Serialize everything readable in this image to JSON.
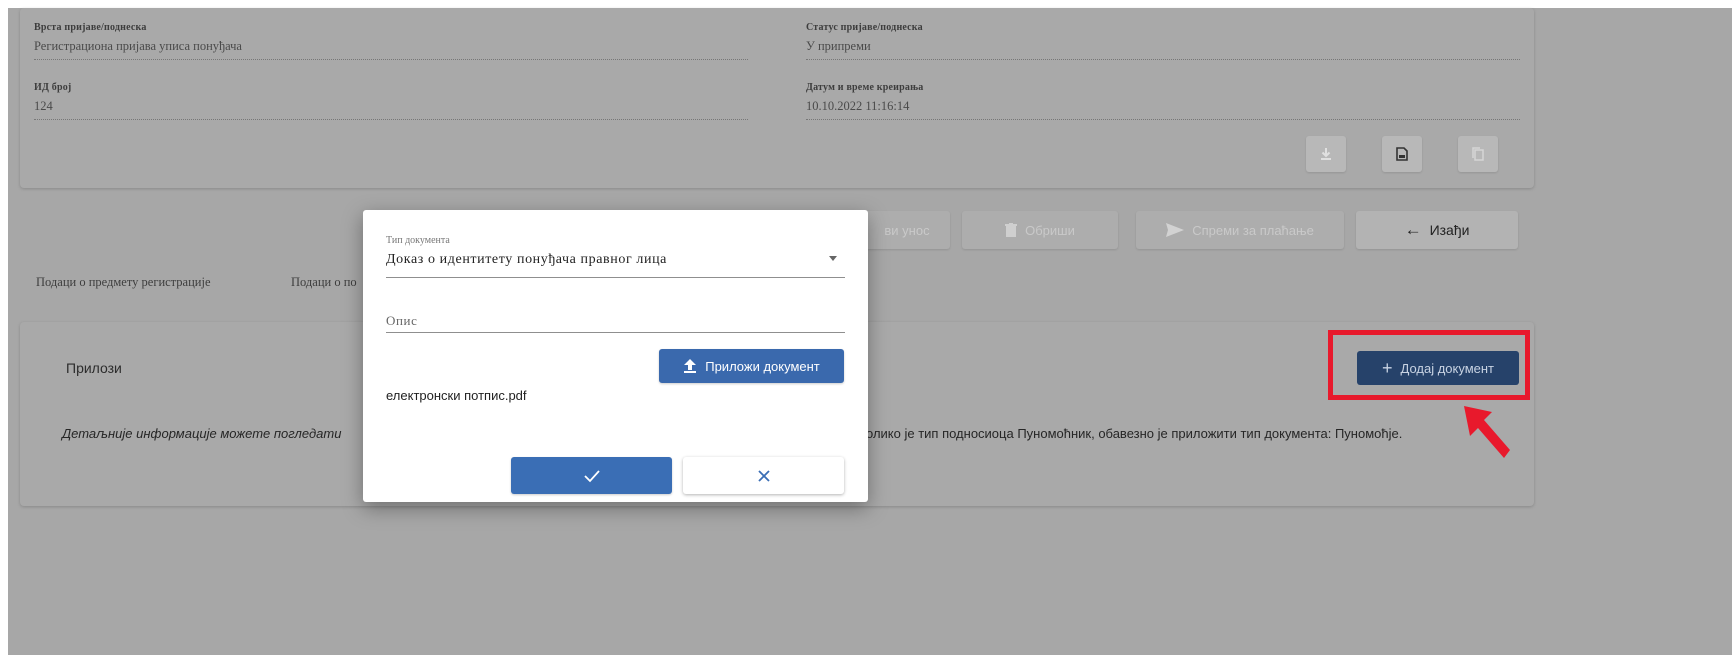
{
  "header_fields": {
    "request_type_label": "Врста пријаве/поднеска",
    "request_type_value": "Регистрациона пријава уписа понуђача",
    "status_label": "Статус пријаве/поднеска",
    "status_value": "У припреми",
    "id_label": "ИД број",
    "id_value": "124",
    "created_label": "Датум и време креирања",
    "created_value": "10.10.2022 11:16:14"
  },
  "header_icons": [
    "download-icon",
    "save-icon",
    "copy-icon"
  ],
  "actions": {
    "save_entry_partial": "ви унос",
    "delete": "Обриши",
    "send_for_payment": "Спреми за плаћање",
    "exit": "Изађи"
  },
  "tabs": {
    "registration_subject": "Подаци о предмету регистрације",
    "second_partial": "Подаци о по"
  },
  "attachments": {
    "title": "Прилози",
    "add_document": "Додај документ",
    "info_left": "Детаљније информације можете погледати",
    "info_right": "олико је тип подносиоца Пуномоћник, обавезно је приложити тип документа: Пуномоћје."
  },
  "modal": {
    "doc_type_label": "Тип документа",
    "doc_type_value": "Доказ о идентитету понуђача правног лица",
    "description_placeholder": "Опис",
    "attach_label": "Приложи документ",
    "file_name": "електронски потпис.pdf"
  },
  "colors": {
    "primary": "#3a6eb5",
    "primary_dimmed": "#26426a",
    "highlight_red": "#e8192c",
    "overlay_gray": "#a7a7a7"
  }
}
